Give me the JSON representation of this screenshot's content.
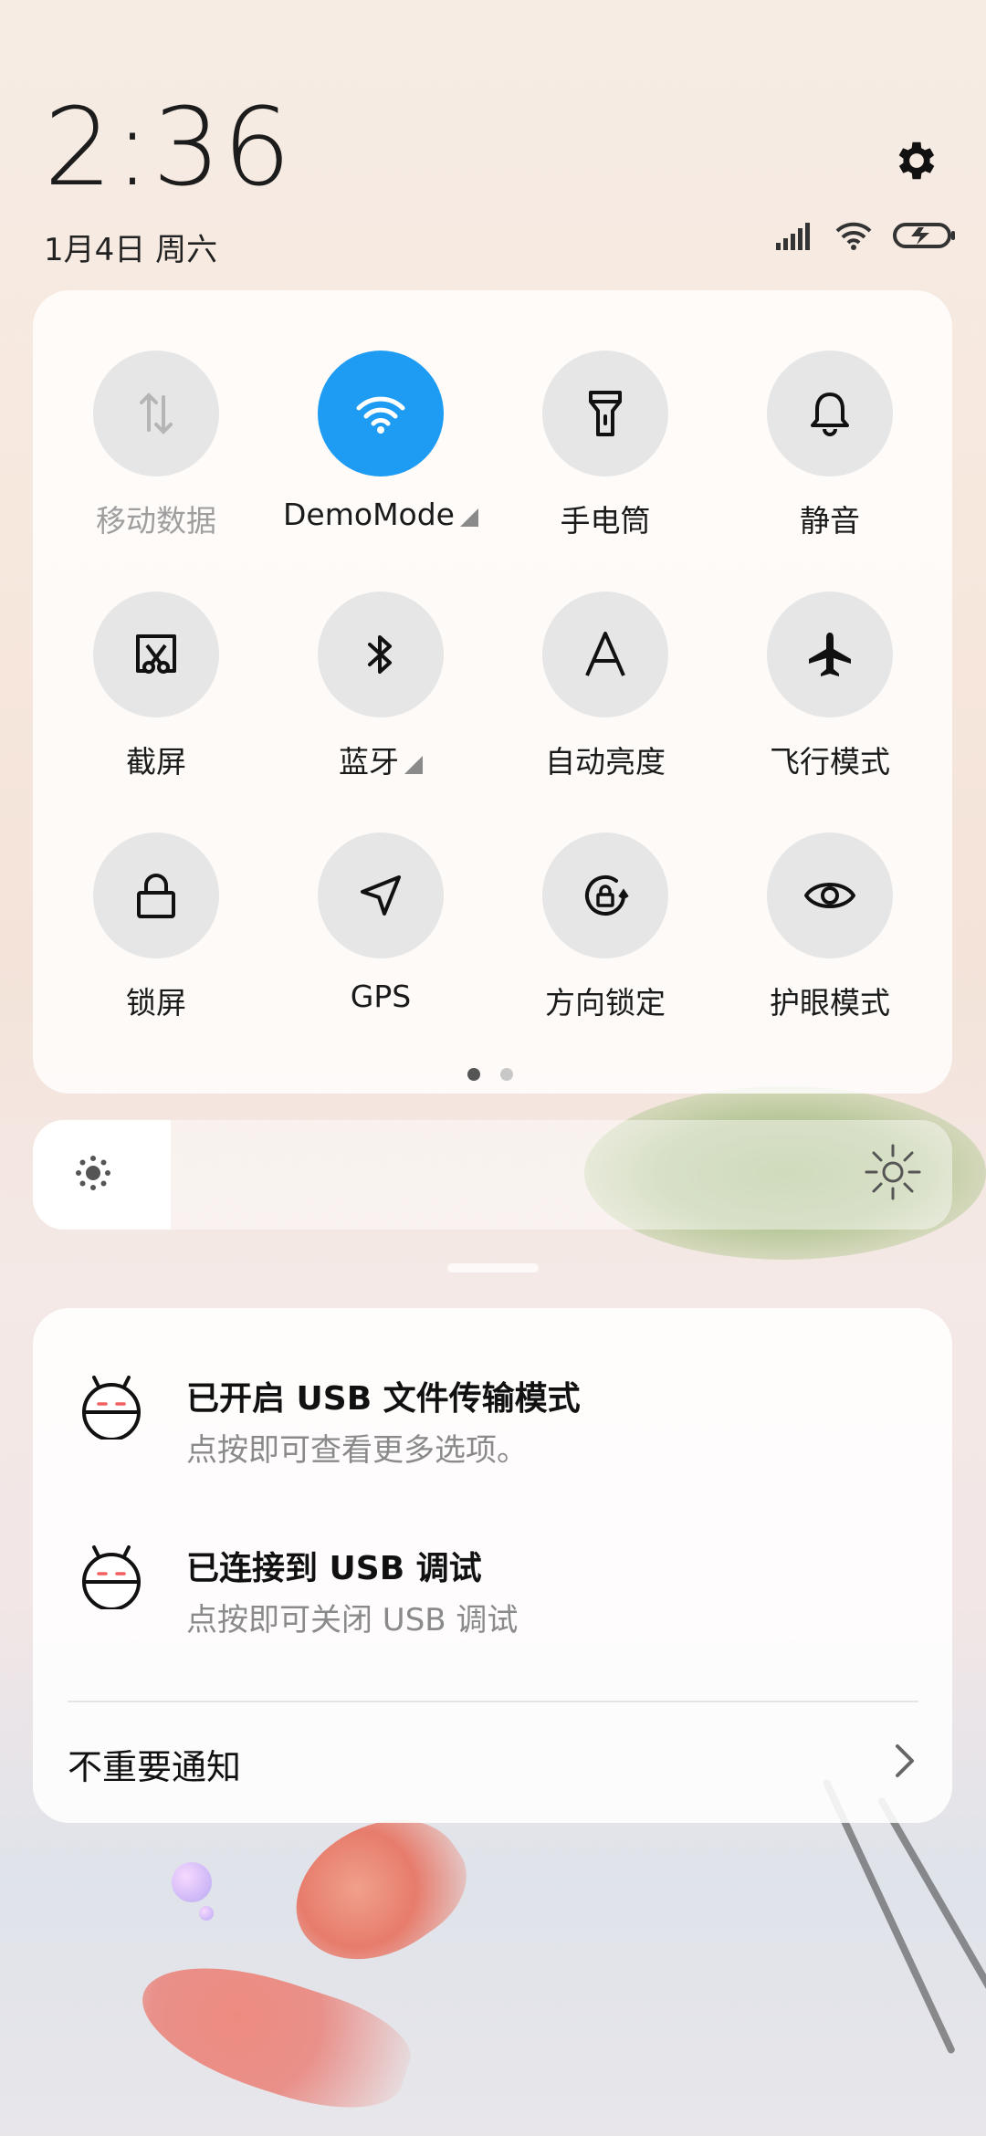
{
  "header": {
    "time": "2:36",
    "date": "1月4日 周六"
  },
  "status_bar": {
    "icons": [
      "signal-icon",
      "wifi-icon",
      "battery-charging-icon"
    ]
  },
  "quick_settings": {
    "tiles": [
      {
        "label": "移动数据",
        "icon": "mobile-data-icon",
        "active": false,
        "disabled": true
      },
      {
        "label": "DemoMode",
        "icon": "wifi-icon",
        "active": true,
        "expandable": true
      },
      {
        "label": "手电筒",
        "icon": "flashlight-icon",
        "active": false
      },
      {
        "label": "静音",
        "icon": "bell-icon",
        "active": false
      },
      {
        "label": "截屏",
        "icon": "screenshot-icon",
        "active": false
      },
      {
        "label": "蓝牙",
        "icon": "bluetooth-icon",
        "active": false,
        "expandable": true
      },
      {
        "label": "自动亮度",
        "icon": "auto-brightness-icon",
        "active": false
      },
      {
        "label": "飞行模式",
        "icon": "airplane-icon",
        "active": false
      },
      {
        "label": "锁屏",
        "icon": "lock-icon",
        "active": false
      },
      {
        "label": "GPS",
        "icon": "location-icon",
        "active": false
      },
      {
        "label": "方向锁定",
        "icon": "rotation-lock-icon",
        "active": false
      },
      {
        "label": "护眼模式",
        "icon": "eye-icon",
        "active": false
      }
    ],
    "page_count": 2,
    "current_page": 1
  },
  "brightness": {
    "level": 0.15
  },
  "notifications": {
    "items": [
      {
        "title": "已开启 USB 文件传输模式",
        "subtitle": "点按即可查看更多选项。",
        "icon": "android-icon"
      },
      {
        "title": "已连接到 USB 调试",
        "subtitle": "点按即可关闭 USB 调试",
        "icon": "android-icon"
      }
    ],
    "minor_label": "不重要通知"
  },
  "colors": {
    "accent": "#1e9bf2",
    "tile_bg": "#e6e6e6"
  }
}
